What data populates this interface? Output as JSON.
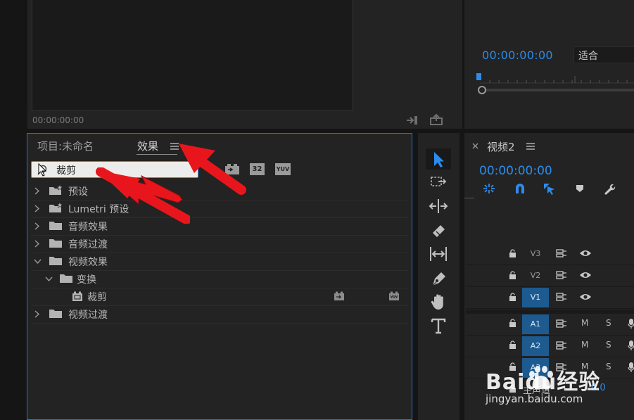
{
  "source_monitor": {
    "timecode": "00:00:00:00"
  },
  "program_monitor": {
    "timecode": "00:00:00:00",
    "fit_label": "适合"
  },
  "effects_panel": {
    "tab_project": "项目:未命名",
    "tab_effects": "效果",
    "search_value": "裁剪",
    "filter_badges": [
      "32",
      "YUV"
    ],
    "tree": [
      {
        "label": "预设",
        "level": 0,
        "expanded": false,
        "kind": "folder-star"
      },
      {
        "label": "Lumetri 预设",
        "level": 0,
        "expanded": false,
        "kind": "folder-star"
      },
      {
        "label": "音频效果",
        "level": 0,
        "expanded": false,
        "kind": "folder"
      },
      {
        "label": "音频过渡",
        "level": 0,
        "expanded": false,
        "kind": "folder"
      },
      {
        "label": "视频效果",
        "level": 0,
        "expanded": true,
        "kind": "folder"
      },
      {
        "label": "变换",
        "level": 1,
        "expanded": true,
        "kind": "folder"
      },
      {
        "label": "裁剪",
        "level": 2,
        "expanded": false,
        "kind": "effect"
      },
      {
        "label": "视频过渡",
        "level": 0,
        "expanded": false,
        "kind": "folder"
      }
    ]
  },
  "timeline": {
    "sequence_name": "视频2",
    "timecode": "00:00:00:00",
    "tracks": [
      {
        "label": "V3",
        "type": "video",
        "targeted": false
      },
      {
        "label": "V2",
        "type": "video",
        "targeted": false
      },
      {
        "label": "V1",
        "type": "video",
        "targeted": true
      },
      {
        "label": "A1",
        "type": "audio",
        "targeted": true
      },
      {
        "label": "A2",
        "type": "audio",
        "targeted": true
      },
      {
        "label": "A3",
        "type": "audio",
        "targeted": true
      }
    ],
    "mute_label": "M",
    "solo_label": "S",
    "master_label": "主声道",
    "master_value": "0.0"
  },
  "watermark": {
    "text": "Baidu经验",
    "url": "jingyan.baidu.com"
  },
  "colors": {
    "accent_blue": "#2d8ceb",
    "annotation_red": "#e8161c",
    "panel": "#232323",
    "background": "#151515"
  }
}
